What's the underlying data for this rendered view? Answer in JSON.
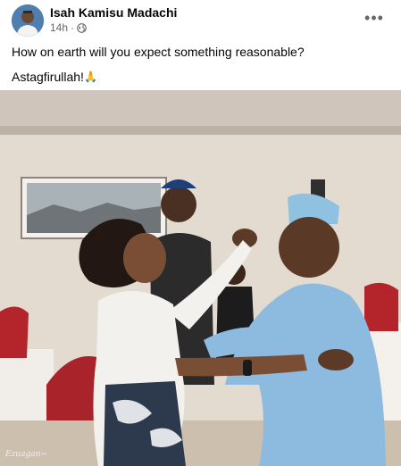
{
  "post": {
    "author": "Isah Kamisu Madachi",
    "time": "14h",
    "separator": "·",
    "privacy_icon": "globe-icon",
    "more_icon": "more-horizontal-icon",
    "more_label": "•••",
    "lines": [
      "How on earth will you expect something reasonable?",
      "Astagfirullah!"
    ],
    "emoji": "🙏",
    "photo": {
      "watermark": "Ezuagan~"
    }
  },
  "colors": {
    "secondary_text": "#65676b",
    "primary_text": "#050505"
  }
}
